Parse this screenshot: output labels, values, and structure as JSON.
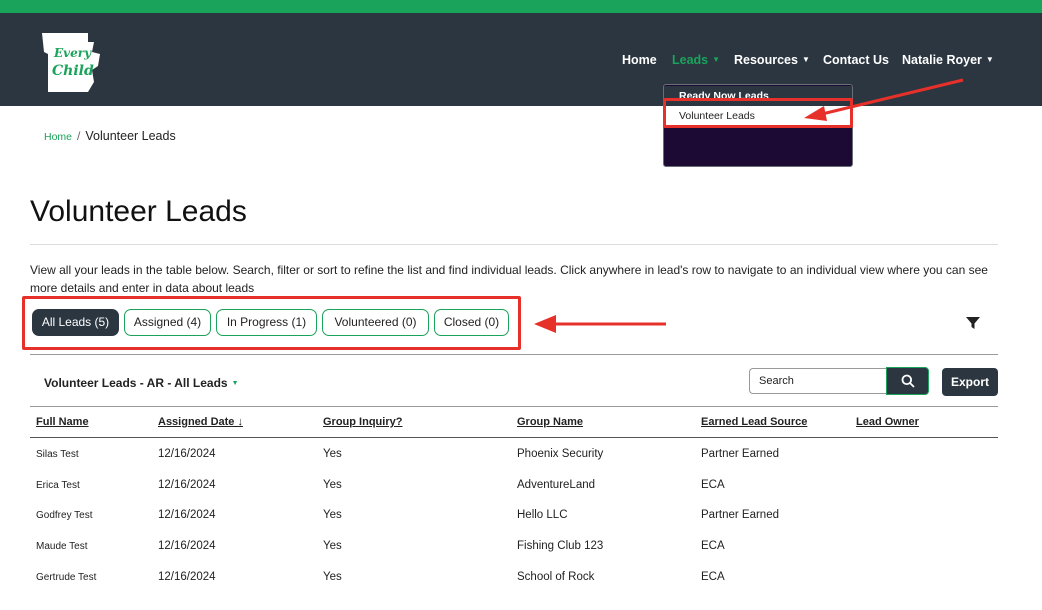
{
  "logo": {
    "text_line1": "Every",
    "text_line2": "Child"
  },
  "nav": {
    "home": "Home",
    "leads": "Leads",
    "resources": "Resources",
    "contact": "Contact Us",
    "user": "Natalie Royer",
    "dropdown": [
      "Ready Now Leads",
      "Volunteer Leads"
    ]
  },
  "breadcrumb": {
    "home": "Home",
    "separator": "/",
    "current": "Volunteer Leads"
  },
  "page": {
    "title": "Volunteer Leads",
    "description": "View all your leads in the table below. Search, filter or sort to refine the list and find individual leads. Click anywhere in lead's row to navigate to an individual view where you can see more details and enter in data about leads"
  },
  "filters": [
    "All Leads (5)",
    "Assigned (4)",
    "In Progress (1)",
    "Volunteered (0)",
    "Closed (0)"
  ],
  "table": {
    "title": "Volunteer Leads - AR - All Leads",
    "search_placeholder": "Search",
    "export_label": "Export",
    "headers": [
      "Full Name",
      "Assigned Date ↓",
      "Group Inquiry?",
      "Group Name",
      "Earned Lead Source",
      "Lead Owner"
    ],
    "rows": [
      [
        "Silas Test",
        "12/16/2024",
        "Yes",
        "Phoenix Security",
        "Partner Earned",
        ""
      ],
      [
        "Erica Test",
        "12/16/2024",
        "Yes",
        "AdventureLand",
        "ECA",
        ""
      ],
      [
        "Godfrey Test",
        "12/16/2024",
        "Yes",
        "Hello LLC",
        "Partner Earned",
        ""
      ],
      [
        "Maude Test",
        "12/16/2024",
        "Yes",
        "Fishing Club 123",
        "ECA",
        ""
      ],
      [
        "Gertrude Test",
        "12/16/2024",
        "Yes",
        "School of Rock",
        "ECA",
        ""
      ]
    ]
  },
  "colors": {
    "accent": "#1aa35a",
    "navbar": "#2b3640",
    "highlight": "#e8302a"
  },
  "icons": [
    "logo-icon",
    "chevron-down-icon",
    "filter-icon",
    "search-icon",
    "arrow-icon"
  ]
}
